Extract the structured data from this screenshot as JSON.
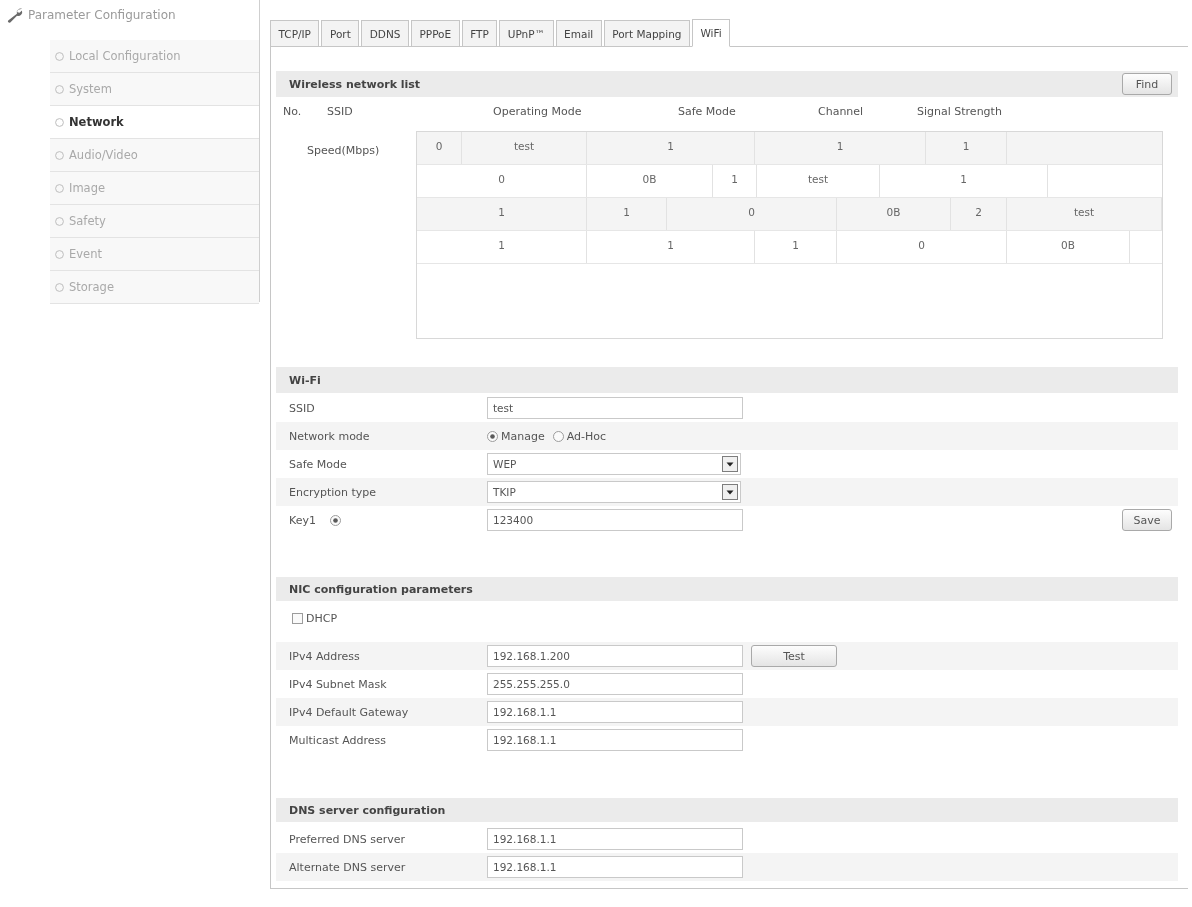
{
  "sidebar": {
    "title": "Parameter Configuration",
    "items": [
      {
        "label": "Local Configuration",
        "selected": false
      },
      {
        "label": "System",
        "selected": false
      },
      {
        "label": "Network",
        "selected": true
      },
      {
        "label": "Audio/Video",
        "selected": false
      },
      {
        "label": "Image",
        "selected": false
      },
      {
        "label": "Safety",
        "selected": false
      },
      {
        "label": "Event",
        "selected": false
      },
      {
        "label": "Storage",
        "selected": false
      }
    ]
  },
  "tabs": [
    {
      "label": "TCP/IP",
      "selected": false
    },
    {
      "label": "Port",
      "selected": false
    },
    {
      "label": "DDNS",
      "selected": false
    },
    {
      "label": "PPPoE",
      "selected": false
    },
    {
      "label": "FTP",
      "selected": false
    },
    {
      "label": "UPnP™",
      "selected": false
    },
    {
      "label": "Email",
      "selected": false
    },
    {
      "label": "Port Mapping",
      "selected": false
    },
    {
      "label": "WiFi",
      "selected": true
    }
  ],
  "wireless_list": {
    "title": "Wireless network list",
    "find_button": "Find",
    "header_labels": [
      "No.",
      "SSID",
      "Operating Mode",
      "Safe Mode",
      "Channel",
      "Signal Strength"
    ],
    "wrapped_label": "Speed(Mbps)",
    "result_box": {
      "lines": [
        [
          "0",
          "test",
          "1",
          "1",
          "1"
        ],
        [
          "0",
          "0B",
          "1",
          "test",
          "1"
        ],
        [
          "1",
          "1",
          "0",
          "0B",
          "2",
          "test"
        ],
        [
          "1",
          "1",
          "1",
          "0",
          "0B"
        ]
      ]
    }
  },
  "wifi": {
    "title": "Wi-Fi",
    "fields": [
      {
        "kind": "text",
        "label": "SSID",
        "value": "test"
      },
      {
        "kind": "radio",
        "label": "Network mode",
        "options": [
          {
            "label": "Manage",
            "selected": true
          },
          {
            "label": "Ad-Hoc",
            "selected": false
          }
        ]
      },
      {
        "kind": "select",
        "label": "Safe Mode",
        "value": "WEP"
      },
      {
        "kind": "select",
        "label": "Encryption type",
        "value": "TKIP"
      },
      {
        "kind": "key",
        "label": "Key1",
        "selected": true,
        "value": "123400"
      }
    ],
    "save_button": "Save"
  },
  "nic": {
    "title": "NIC configuration parameters",
    "fields": [
      {
        "kind": "checkbox",
        "label": "DHCP",
        "checked": false
      },
      {
        "kind": "text",
        "label": "IPv4 Address",
        "value": "192.168.1.200",
        "button": "Test"
      },
      {
        "kind": "text",
        "label": "IPv4 Subnet Mask",
        "value": "255.255.255.0"
      },
      {
        "kind": "text",
        "label": "IPv4 Default Gateway",
        "value": "192.168.1.1"
      },
      {
        "kind": "text",
        "label": "Multicast Address",
        "value": "192.168.1.1"
      }
    ]
  },
  "dns": {
    "title": "DNS server configuration",
    "fields": [
      {
        "kind": "text",
        "label": "Preferred DNS server",
        "value": "192.168.1.1"
      },
      {
        "kind": "text",
        "label": "Alternate DNS server",
        "value": "192.168.1.1"
      }
    ]
  }
}
